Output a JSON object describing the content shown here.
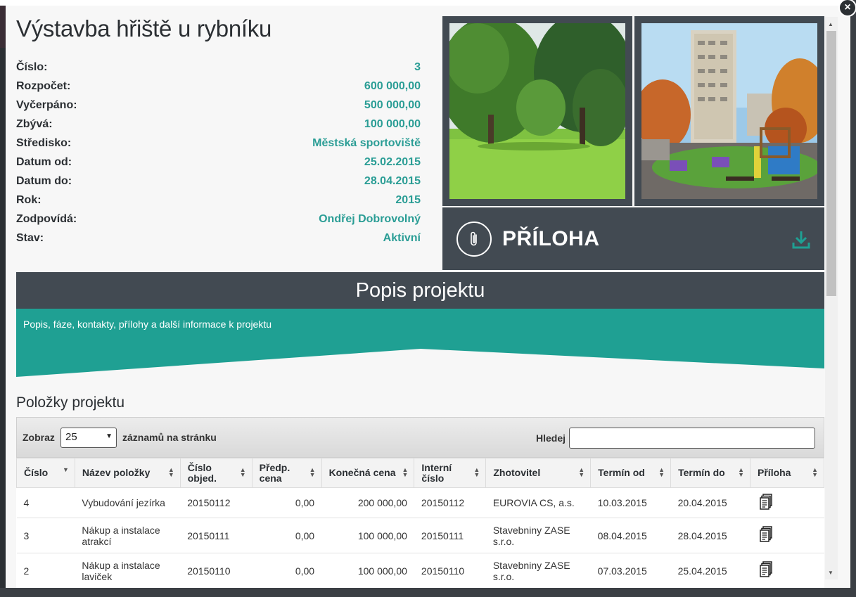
{
  "close_glyph": "×",
  "project": {
    "title": "Výstavba hřiště u rybníku",
    "fields": [
      {
        "label": "Číslo:",
        "value": "3"
      },
      {
        "label": "Rozpočet:",
        "value": "600 000,00"
      },
      {
        "label": "Vyčerpáno:",
        "value": "500 000,00"
      },
      {
        "label": "Zbývá:",
        "value": "100 000,00"
      },
      {
        "label": "Středisko:",
        "value": "Městská sportoviště"
      },
      {
        "label": "Datum od:",
        "value": "25.02.2015"
      },
      {
        "label": "Datum do:",
        "value": "28.04.2015"
      },
      {
        "label": "Rok:",
        "value": "2015"
      },
      {
        "label": "Zodpovídá:",
        "value": "Ondřej Dobrovolný"
      },
      {
        "label": "Stav:",
        "value": "Aktivní"
      }
    ]
  },
  "attachment": {
    "label": "PŘÍLOHA",
    "icons": [
      "paperclip-icon",
      "download-icon"
    ]
  },
  "description": {
    "heading": "Popis projektu",
    "text": "Popis, fáze, kontakty, přílohy a další informace k projektu"
  },
  "items": {
    "title": "Položky projektu",
    "toolbar": {
      "show_label": "Zobraz",
      "page_size": "25",
      "records_label": "záznamů na stránku",
      "search_label": "Hledej",
      "search_value": ""
    },
    "columns": [
      {
        "line1": "Číslo",
        "line2": ""
      },
      {
        "line1": "Název položky",
        "line2": ""
      },
      {
        "line1": "Číslo",
        "line2": "objed."
      },
      {
        "line1": "Předp.",
        "line2": "cena"
      },
      {
        "line1": "Konečná cena",
        "line2": ""
      },
      {
        "line1": "Interní",
        "line2": "číslo"
      },
      {
        "line1": "Zhotovitel",
        "line2": ""
      },
      {
        "line1": "Termín od",
        "line2": ""
      },
      {
        "line1": "Termín do",
        "line2": ""
      },
      {
        "line1": "Příloha",
        "line2": ""
      }
    ],
    "rows": [
      {
        "cislo": "4",
        "nazev": "Vybudování jezírka",
        "objed": "20150112",
        "predp": "0,00",
        "konecna": "200 000,00",
        "interni": "20150112",
        "zhotovitel": "EUROVIA CS, a.s.",
        "od": "10.03.2015",
        "do": "20.04.2015"
      },
      {
        "cislo": "3",
        "nazev": "Nákup a instalace atrakcí",
        "objed": "20150111",
        "predp": "0,00",
        "konecna": "100 000,00",
        "interni": "20150111",
        "zhotovitel": "Stavebniny ZASE s.r.o.",
        "od": "08.04.2015",
        "do": "28.04.2015"
      },
      {
        "cislo": "2",
        "nazev": "Nákup a instalace laviček",
        "objed": "20150110",
        "predp": "0,00",
        "konecna": "100 000,00",
        "interni": "20150110",
        "zhotovitel": "Stavebniny ZASE s.r.o.",
        "od": "07.03.2015",
        "do": "25.04.2015"
      }
    ]
  },
  "colors": {
    "accent": "#2a9d95",
    "teal_panel": "#1fa093",
    "dark_panel": "#424a52"
  }
}
